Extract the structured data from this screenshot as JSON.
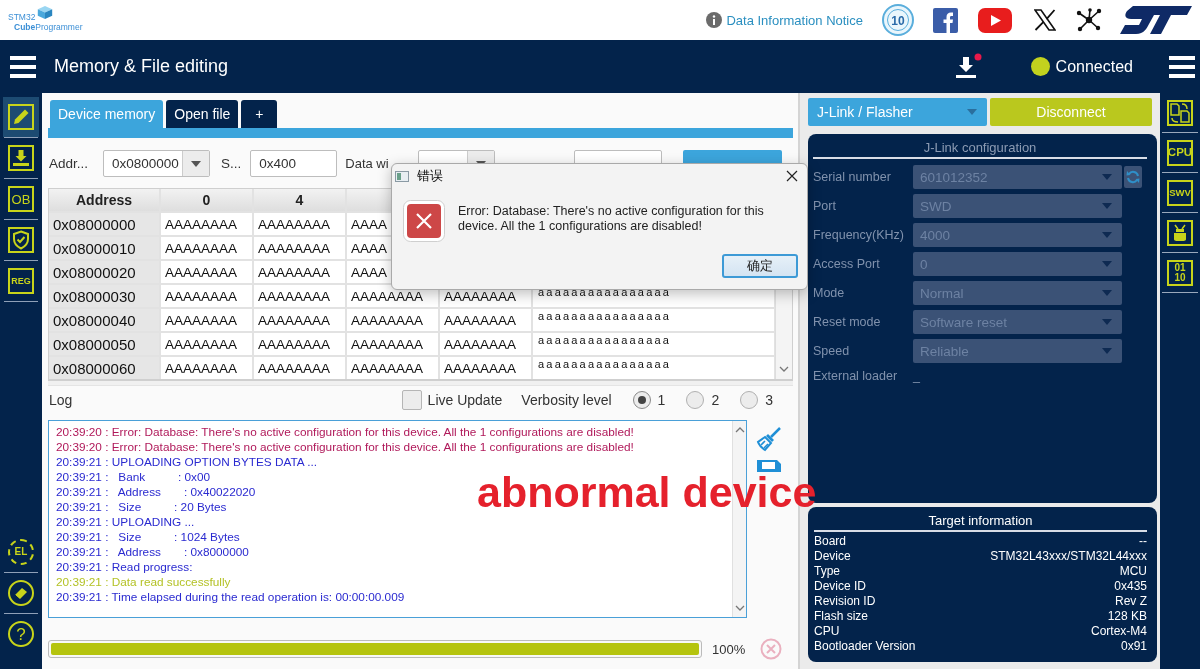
{
  "header": {
    "logo": {
      "line1": "STM32",
      "line2": "**Cube**Programmer"
    },
    "notice_link": "Data Information Notice",
    "badge": "10"
  },
  "navbar": {
    "title": "Memory & File editing",
    "download_notification": true,
    "status": {
      "label": "Connected",
      "connected": true
    }
  },
  "left_sidebar": {
    "items": [
      {
        "kind": "edit",
        "selected": true
      },
      {
        "kind": "download",
        "selected": false
      },
      {
        "kind": "ob",
        "label": "OB",
        "selected": false
      },
      {
        "kind": "shield",
        "selected": false
      },
      {
        "kind": "reg",
        "label": "REG",
        "selected": false
      }
    ],
    "bottom_items": [
      {
        "kind": "chip",
        "label": "EL"
      },
      {
        "kind": "eraser"
      },
      {
        "kind": "help",
        "label": "?"
      }
    ]
  },
  "tabs": [
    {
      "label": "Device memory",
      "selected": true
    },
    {
      "label": "Open file",
      "selected": false
    },
    {
      "label": "+",
      "selected": false
    }
  ],
  "toolbar": {
    "address_label": "Addr...",
    "address_value": "0x0800000",
    "size_label": "S...",
    "size_value": "0x400",
    "data_width_label": "Data wi"
  },
  "table": {
    "columns": [
      "Address",
      "0",
      "4"
    ],
    "rows": [
      {
        "cells": [
          "0x08000000",
          "AAAAAAAA",
          "AAAAAAAA",
          "AAAA"
        ]
      },
      {
        "cells": [
          "0x08000010",
          "AAAAAAAA",
          "AAAAAAAA",
          "AAAA"
        ]
      },
      {
        "cells": [
          "0x08000020",
          "AAAAAAAA",
          "AAAAAAAA",
          "AAAA"
        ]
      },
      {
        "cells": [
          "0x08000030",
          "AAAAAAAA",
          "AAAAAAAA",
          "AAAAAAAA",
          "AAAAAAAA",
          "aaaaaaaaaaaaaaaa"
        ]
      },
      {
        "cells": [
          "0x08000040",
          "AAAAAAAA",
          "AAAAAAAA",
          "AAAAAAAA",
          "AAAAAAAA",
          "aaaaaaaaaaaaaaaa"
        ]
      },
      {
        "cells": [
          "0x08000050",
          "AAAAAAAA",
          "AAAAAAAA",
          "AAAAAAAA",
          "AAAAAAAA",
          "aaaaaaaaaaaaaaaa"
        ]
      },
      {
        "cells": [
          "0x08000060",
          "AAAAAAAA",
          "AAAAAAAA",
          "AAAAAAAA",
          "AAAAAAAA",
          "aaaaaaaaaaaaaaaa"
        ]
      }
    ]
  },
  "log": {
    "title": "Log",
    "live_update": {
      "label": "Live Update",
      "checked": false
    },
    "verbosity": {
      "label": "Verbosity level",
      "options": [
        {
          "label": "1",
          "selected": true
        },
        {
          "label": "2",
          "selected": false
        },
        {
          "label": "3",
          "selected": false
        }
      ]
    },
    "lines": [
      {
        "kind": "error",
        "text": "20:39:20 : Error: Database: There's no active configuration for this device. All the 1 configurations are disabled!"
      },
      {
        "kind": "error",
        "text": "20:39:20 : Error: Database: There's no active configuration for this device. All the 1 configurations are disabled!"
      },
      {
        "kind": "info",
        "text": "20:39:21 : UPLOADING OPTION BYTES DATA ..."
      },
      {
        "kind": "info",
        "text": "20:39:21 :   Bank          : 0x00"
      },
      {
        "kind": "info",
        "text": "20:39:21 :   Address       : 0x40022020"
      },
      {
        "kind": "info",
        "text": "20:39:21 :   Size          : 20 Bytes"
      },
      {
        "kind": "info",
        "text": "20:39:21 : UPLOADING ..."
      },
      {
        "kind": "info",
        "text": "20:39:21 :   Size          : 1024 Bytes"
      },
      {
        "kind": "info",
        "text": "20:39:21 :   Address       : 0x8000000"
      },
      {
        "kind": "info",
        "text": "20:39:21 : Read progress:"
      },
      {
        "kind": "success",
        "text": "20:39:21 : Data read successfully"
      },
      {
        "kind": "info",
        "text": "20:39:21 : Time elapsed during the read operation is: 00:00:00.009"
      }
    ]
  },
  "progress": {
    "level": 1,
    "reading": "100%",
    "cancel_enabled": false
  },
  "probe": {
    "selected": "J-Link / Flasher",
    "button": "Disconnect"
  },
  "config": {
    "title": "J-Link configuration",
    "disabled": true,
    "fields": [
      {
        "kind": "combo",
        "label": "Serial number",
        "value": "601012352",
        "refresh": true
      },
      {
        "kind": "combo",
        "label": "Port",
        "value": "SWD",
        "refresh": false
      },
      {
        "kind": "combo",
        "label": "Frequency(KHz)",
        "value": "4000",
        "refresh": false
      },
      {
        "kind": "combo",
        "label": "Access Port",
        "value": "0",
        "refresh": false
      },
      {
        "kind": "combo",
        "label": "Mode",
        "value": "Normal",
        "refresh": false
      },
      {
        "kind": "combo",
        "label": "Reset mode",
        "value": "Software reset",
        "refresh": false
      },
      {
        "kind": "combo",
        "label": "Speed",
        "value": "Reliable",
        "refresh": false
      },
      {
        "kind": "text",
        "label": "External loader",
        "value": "_",
        "refresh": false
      }
    ]
  },
  "target": {
    "title": "Target information",
    "rows": [
      {
        "label": "Board",
        "value": "--"
      },
      {
        "label": "Device",
        "value": "STM32L43xxx/STM32L44xxx"
      },
      {
        "label": "Type",
        "value": "MCU"
      },
      {
        "label": "Device ID",
        "value": "0x435"
      },
      {
        "label": "Revision ID",
        "value": "Rev Z"
      },
      {
        "label": "Flash size",
        "value": "128 KB"
      },
      {
        "label": "CPU",
        "value": "Cortex-M4"
      },
      {
        "label": "Bootloader Version",
        "value": "0x91"
      }
    ]
  },
  "right_sidebar": {
    "items": [
      {
        "kind": "pages"
      },
      {
        "kind": "cpu",
        "label": "CPU"
      },
      {
        "kind": "swv",
        "label": "SWV"
      },
      {
        "kind": "bug"
      },
      {
        "kind": "binary",
        "lines": [
          "01",
          "10"
        ]
      }
    ]
  },
  "dialog": {
    "title": "错误",
    "message": "Error: Database: There's no active configuration for this device. All the 1 configurations are disabled!",
    "button": "确定"
  },
  "annotation": {
    "text": "abnormal device"
  }
}
